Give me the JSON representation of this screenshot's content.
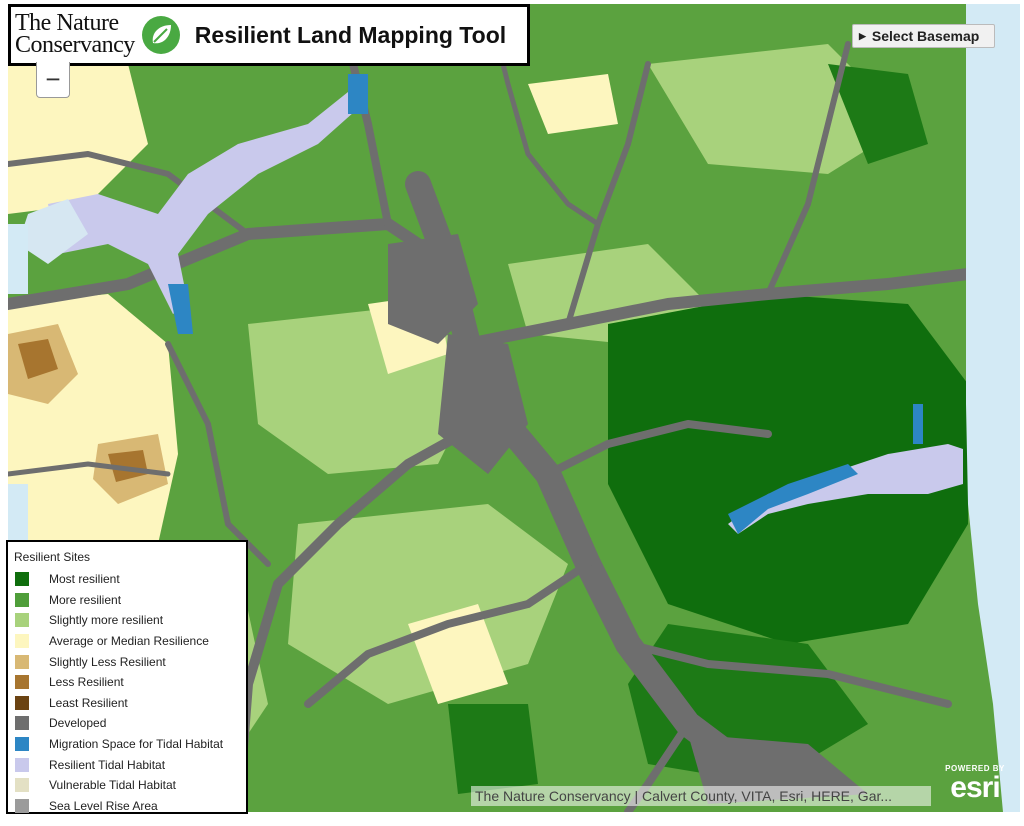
{
  "header": {
    "logo_line1": "The Nature",
    "logo_line2": "Conservancy",
    "title": "Resilient Land Mapping Tool"
  },
  "controls": {
    "zoom_out": "−",
    "basemap_label": "Select Basemap"
  },
  "legend": {
    "title": "Resilient Sites",
    "items": [
      {
        "label": "Most resilient",
        "color": "#0f6e0d"
      },
      {
        "label": "More resilient",
        "color": "#4f9e3a"
      },
      {
        "label": "Slightly more resilient",
        "color": "#a8d27c"
      },
      {
        "label": "Average or Median Resilience",
        "color": "#fdf6bf"
      },
      {
        "label": "Slightly Less Resilient",
        "color": "#d8b874"
      },
      {
        "label": "Less Resilient",
        "color": "#a7752f"
      },
      {
        "label": "Least Resilient",
        "color": "#6b4312"
      },
      {
        "label": "Developed",
        "color": "#6e6e6e"
      },
      {
        "label": "Migration Space for Tidal Habitat",
        "color": "#2d86c4"
      },
      {
        "label": "Resilient Tidal Habitat",
        "color": "#c9c9ec"
      },
      {
        "label": "Vulnerable Tidal Habitat",
        "color": "#e3e0c4"
      },
      {
        "label": "Sea Level Rise Area",
        "color": "#9b9b9b"
      }
    ]
  },
  "attribution": "The Nature Conservancy | Calvert County, VITA, Esri, HERE, Gar...",
  "esri": {
    "powered": "POWERED BY",
    "mark": "esri"
  }
}
